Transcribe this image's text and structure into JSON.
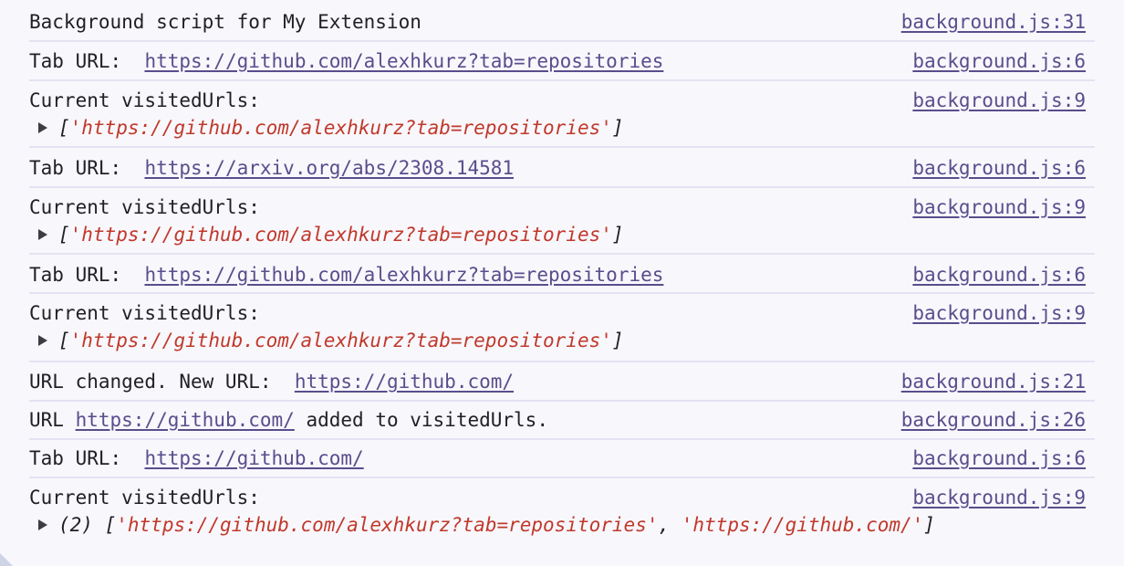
{
  "entries": [
    {
      "prefix": "Background script for My Extension",
      "source": "background.js:31"
    },
    {
      "prefix": "Tab URL:",
      "link": "https://github.com/alexhkurz?tab=repositories",
      "source": "background.js:6"
    },
    {
      "prefix": "Current visitedUrls:",
      "source": "background.js:9",
      "array": {
        "open": "[",
        "items": [
          "'https://github.com/alexhkurz?tab=repositories'"
        ],
        "close": "]"
      }
    },
    {
      "prefix": "Tab URL:",
      "link": "https://arxiv.org/abs/2308.14581",
      "source": "background.js:6"
    },
    {
      "prefix": "Current visitedUrls:",
      "source": "background.js:9",
      "array": {
        "open": "[",
        "items": [
          "'https://github.com/alexhkurz?tab=repositories'"
        ],
        "close": "]"
      }
    },
    {
      "prefix": "Tab URL:",
      "link": "https://github.com/alexhkurz?tab=repositories",
      "source": "background.js:6"
    },
    {
      "prefix": "Current visitedUrls:",
      "source": "background.js:9",
      "array": {
        "open": "[",
        "items": [
          "'https://github.com/alexhkurz?tab=repositories'"
        ],
        "close": "]"
      }
    },
    {
      "prefix": "URL changed. New URL:",
      "link": "https://github.com/",
      "source": "background.js:21"
    },
    {
      "prefix": "URL",
      "link": "https://github.com/",
      "suffix": "added to visitedUrls.",
      "source": "background.js:26"
    },
    {
      "prefix": "Tab URL:",
      "link": "https://github.com/",
      "source": "background.js:6"
    },
    {
      "prefix": "Current visitedUrls:",
      "source": "background.js:9",
      "array": {
        "count": "(2)",
        "open": "[",
        "items": [
          "'https://github.com/alexhkurz?tab=repositories'",
          "'https://github.com/'"
        ],
        "separator": ", ",
        "close": "]"
      }
    }
  ],
  "colors": {
    "background": "#f8f7fc",
    "separator": "#e4e2f1",
    "link": "#5a4d8c",
    "string": "#c0392b",
    "text": "#202124"
  }
}
